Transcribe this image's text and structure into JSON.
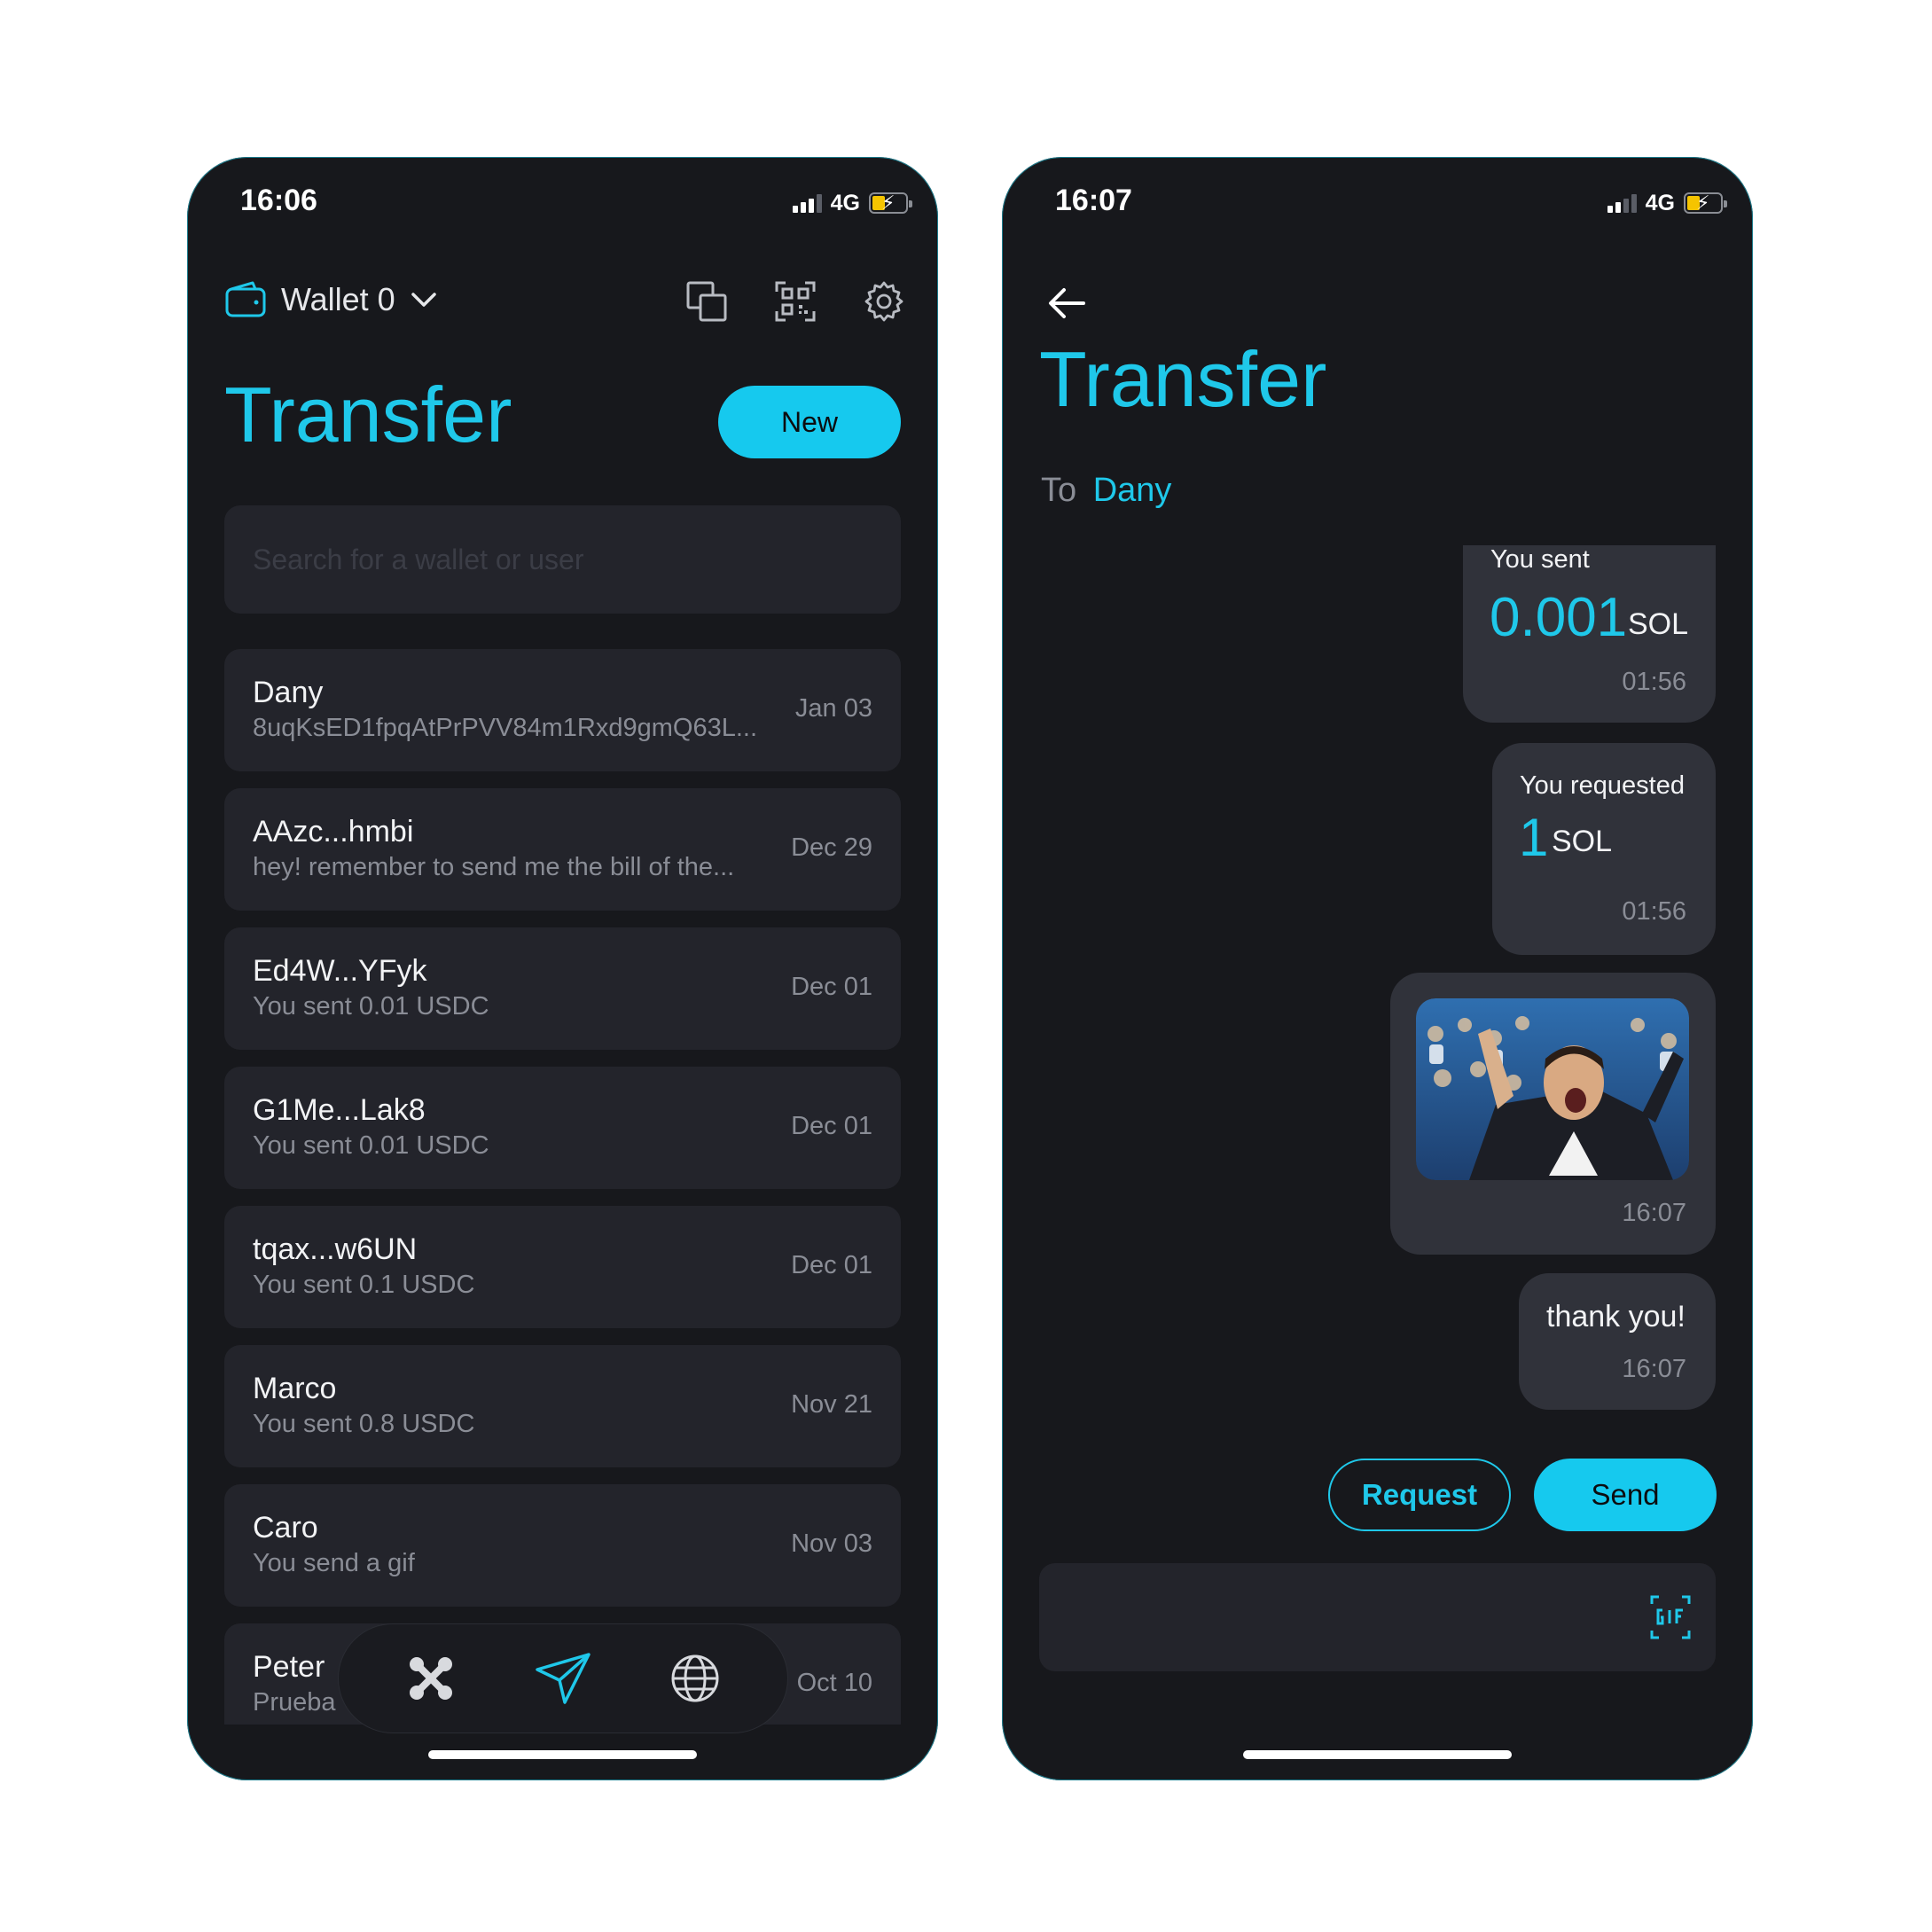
{
  "left": {
    "status": {
      "time": "16:06",
      "network": "4G"
    },
    "wallet_label": "Wallet 0",
    "title": "Transfer",
    "new_button": "New",
    "search_placeholder": "Search for a wallet or user",
    "conversations": [
      {
        "name": "Dany",
        "subtitle": "8uqKsED1fpqAtPrPVV84m1Rxd9gmQ63L...",
        "date": "Jan 03"
      },
      {
        "name": "AAzc...hmbi",
        "subtitle": "hey! remember to send me the bill of the...",
        "date": "Dec 29"
      },
      {
        "name": "Ed4W...YFyk",
        "subtitle": "You sent 0.01 USDC",
        "date": "Dec 01"
      },
      {
        "name": "G1Me...Lak8",
        "subtitle": "You sent 0.01 USDC",
        "date": "Dec 01"
      },
      {
        "name": "tqax...w6UN",
        "subtitle": "You sent 0.1 USDC",
        "date": "Dec 01"
      },
      {
        "name": "Marco",
        "subtitle": "You sent 0.8 USDC",
        "date": "Nov 21"
      },
      {
        "name": "Caro",
        "subtitle": "You send a gif",
        "date": "Nov 03"
      },
      {
        "name": "Peter",
        "subtitle": "Prueba",
        "date": "Oct 10"
      }
    ],
    "tabs": [
      "apps-icon",
      "send-icon",
      "globe-icon"
    ]
  },
  "right": {
    "status": {
      "time": "16:07",
      "network": "4G"
    },
    "title": "Transfer",
    "to_label": "To",
    "to_name": "Dany",
    "messages": {
      "sent": {
        "label": "You sent",
        "amount": "0.001",
        "unit": "SOL",
        "time": "01:56"
      },
      "requested": {
        "label": "You requested",
        "amount": "1",
        "unit": "SOL",
        "time": "01:56"
      },
      "gif": {
        "time": "16:07"
      },
      "text": {
        "text": "thank you!",
        "time": "16:07"
      }
    },
    "request_button": "Request",
    "send_button": "Send"
  },
  "colors": {
    "accent": "#16c9ee",
    "background": "#17181c",
    "card": "#23242b",
    "bubble": "#30323a"
  }
}
